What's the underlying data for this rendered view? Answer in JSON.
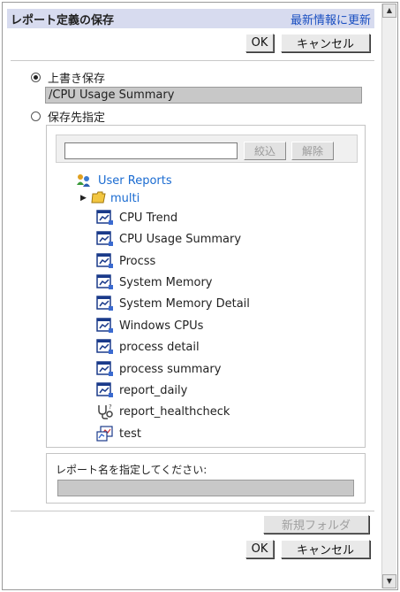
{
  "header": {
    "title": "レポート定義の保存",
    "refresh_link": "最新情報に更新"
  },
  "buttons": {
    "ok": "OK",
    "cancel": "キャンセル",
    "new_folder": "新規フォルダ"
  },
  "overwrite": {
    "label": "上書き保存",
    "selected": true,
    "value": "/CPU Usage Summary"
  },
  "destination": {
    "label": "保存先指定",
    "selected": false,
    "filter_placeholder": "",
    "filter_button": "絞込",
    "clear_button": "解除"
  },
  "tree": {
    "root": "User Reports",
    "folder": "multi",
    "reports": [
      "CPU Trend",
      "CPU Usage Summary",
      "Procss",
      "System Memory",
      "System Memory Detail",
      "Windows CPUs",
      "process detail",
      "process summary",
      "report_daily",
      "report_healthcheck",
      "test"
    ],
    "icons": {
      "root": "user-reports-icon",
      "folder": "folder-icon",
      "report": "report-chart-icon",
      "healthcheck": "stethoscope-icon",
      "test": "combo-report-icon"
    }
  },
  "report_name": {
    "label": "レポート名を指定してください:",
    "value": ""
  },
  "colors": {
    "header_bg": "#d7dbef",
    "link": "#1a4fc1",
    "tree_link": "#1a6bd1"
  }
}
